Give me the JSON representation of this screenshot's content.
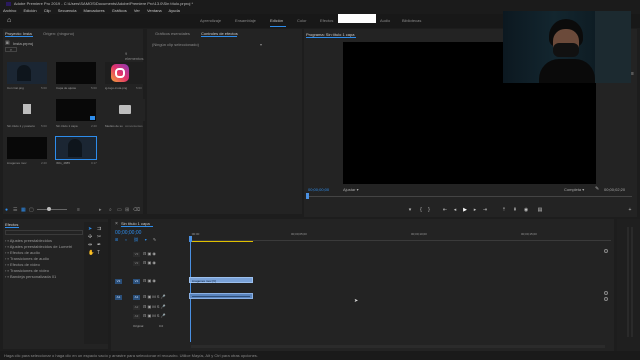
{
  "titlebar": {
    "text": "Adobe Premiere Pro 2019 - C:\\Users\\SAMOS\\Documents\\Adobe\\Premiere Pro\\13.0\\Sin título.prproj *"
  },
  "menubar": {
    "items": [
      "Archivo",
      "Edición",
      "Clip",
      "Secuencia",
      "Marcadores",
      "Gráficos",
      "Ver",
      "Ventana",
      "Ayuda"
    ]
  },
  "workspaces": {
    "items": [
      "Aprendizaje",
      "Ensamblaje",
      "Edición",
      "Color",
      "Efectos",
      "Audio",
      "Bibliotecas"
    ],
    "selected": "Edición"
  },
  "project": {
    "tab1": "Proyecto: Insta",
    "tab2": "Origen: (ninguno)",
    "name": "Insta.prproj",
    "count": "9 elementos",
    "items": [
      {
        "name": "Con Cat.png",
        "dur": "5:00"
      },
      {
        "name": "Capa de ajuste",
        "dur": "5:00"
      },
      {
        "name": "ig-logo-insta.png",
        "dur": "5:00"
      },
      {
        "name": "Sin título 1 y posterio",
        "dur": "5:00"
      },
      {
        "name": "Sin título 1 capa",
        "dur": "2:20"
      },
      {
        "name": "Medios de so",
        "dur": "convenientes"
      },
      {
        "name": "imagenes mov",
        "dur": "2:20"
      },
      {
        "name": "IMG_4885",
        "dur": "0:17"
      }
    ]
  },
  "effectcontrols": {
    "tab1": "Gráficos esenciales",
    "tab2": "Controles de efectos",
    "dropdown": "(Ningún clip seleccionado)"
  },
  "program": {
    "title": "Programa: Sin título 1 capa",
    "timecode": "00;00;00;00",
    "fit": "Ajustar",
    "quality": "Completa",
    "duration": "00;00;02;20"
  },
  "effects": {
    "title": "Efectos",
    "items": [
      "Ajustes preestablecidos",
      "Ajustes preestablecidos de Lumetri",
      "Efectos de audio",
      "Transiciones de audio",
      "Efectos de vídeo",
      "Transiciones de vídeo",
      "Bandeja personalizada 01"
    ]
  },
  "timeline": {
    "tab": "Sin título 1 capa",
    "timecode": "00;00;00;00",
    "ruler": [
      ":00:00",
      "00;00;05;00",
      "00;00;10;00",
      "00;00;15;00"
    ],
    "videotracks": [
      "V3",
      "V2",
      "V1"
    ],
    "audiotracks": [
      "A1",
      "A2",
      "A3"
    ],
    "clip": "imagenes mov [V]",
    "master": "Original",
    "masterval": "0.0"
  },
  "statusbar": {
    "text": "Haga clic para seleccionar o haga clic en un espacio vacío y arrastre para seleccionar el recuadro. Utilice Mayús, Alt y Ctrl para otras opciones."
  },
  "colors": {
    "accent": "#2d8ceb",
    "playhead": "#4a90e2"
  }
}
